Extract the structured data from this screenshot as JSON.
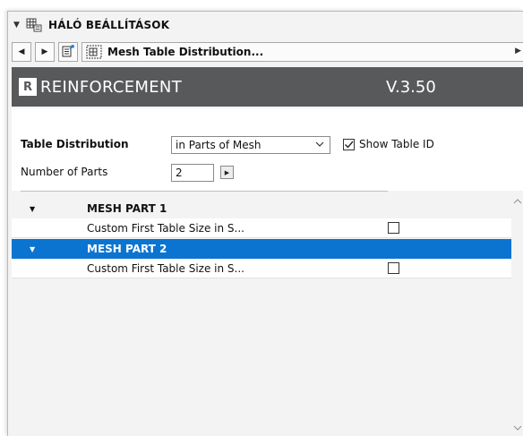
{
  "titlebar": {
    "collapse_icon": "triangle-down-icon",
    "icon": "mesh-settings-icon",
    "title": "HÁLÓ BEÁLLÍTÁSOK"
  },
  "navbar": {
    "back_icon": "triangle-left-icon",
    "forward_icon": "triangle-right-icon",
    "export_icon": "document-arrow-icon",
    "page_icon": "mesh-table-icon",
    "page_title": "Mesh Table Distribution...",
    "more_icon": "triangle-right-icon"
  },
  "banner": {
    "logo_text": "R",
    "title": "REINFORCEMENT",
    "version": "V.3.50",
    "background": "#58595b"
  },
  "settings": {
    "table_distribution_label": "Table Distribution",
    "table_distribution_value": "in Parts of Mesh",
    "show_table_id_label": "Show Table ID",
    "show_table_id_checked": true,
    "number_of_parts_label": "Number of Parts",
    "number_of_parts_value": "2"
  },
  "tree": {
    "rows": [
      {
        "label": "MESH PART 1",
        "type": "header",
        "expanded": true,
        "selected": false
      },
      {
        "label": "Custom First Table Size in S...",
        "type": "option",
        "checked": false
      },
      {
        "label": "MESH PART 2",
        "type": "header",
        "expanded": true,
        "selected": true
      },
      {
        "label": "Custom First Table Size in S...",
        "type": "option",
        "checked": false
      }
    ],
    "selection_color": "#0b74d1"
  }
}
